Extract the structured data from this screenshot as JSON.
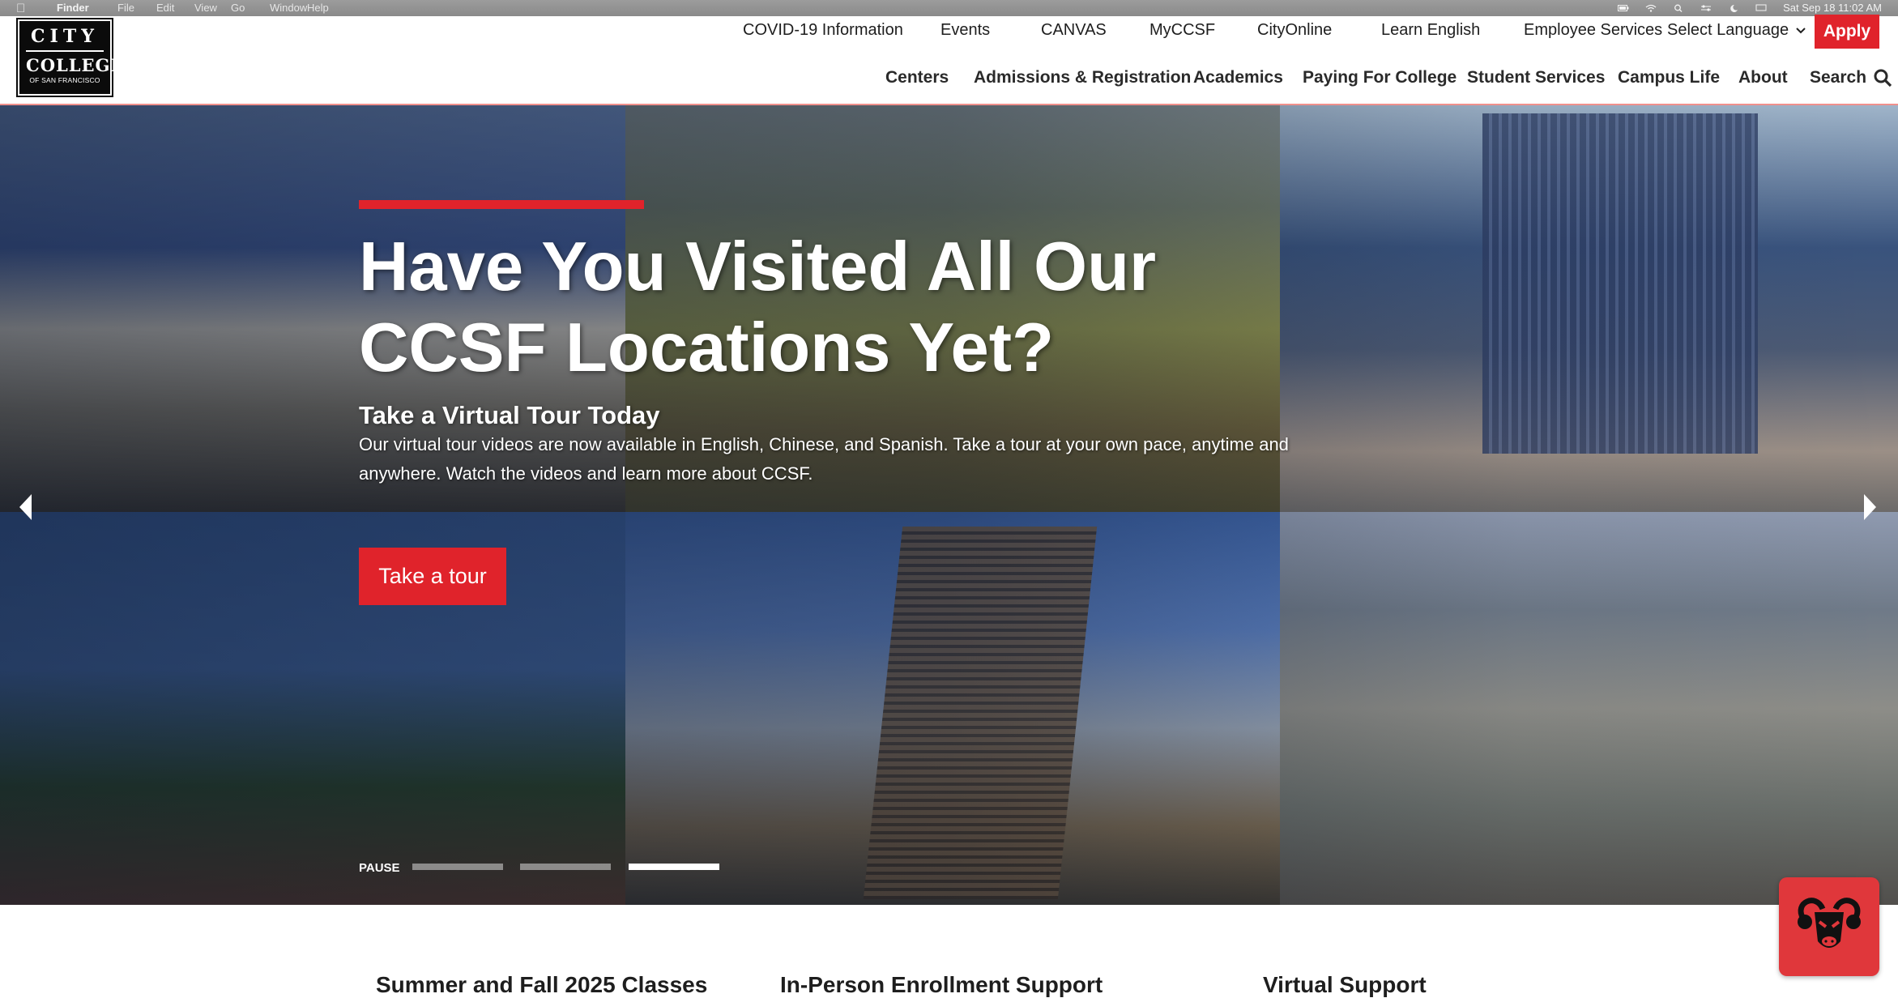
{
  "menubar": {
    "app_name": "Finder",
    "items": [
      "File",
      "Edit",
      "View",
      "Go",
      "Window",
      "Help"
    ],
    "clock": "Sat Sep 18  11:02 AM"
  },
  "logo": {
    "line1": "CITY",
    "line2": "COLLEGE",
    "line3": "OF SAN FRANCISCO"
  },
  "utility_nav": [
    "COVID-19 Information",
    "Events",
    "CANVAS",
    "MyCCSF",
    "CityOnline",
    "Learn English",
    "Employee Services"
  ],
  "language": {
    "label": "Select Language"
  },
  "apply_label": "Apply",
  "main_nav": [
    "Centers",
    "Admissions & Registration",
    "Academics",
    "Paying For College",
    "Student Services",
    "Campus Life",
    "About"
  ],
  "search_label": "Search",
  "hero": {
    "headline_line1": "Have You Visited All Our",
    "headline_line2": "CCSF Locations Yet?",
    "subheading": "Take a Virtual Tour Today",
    "description": "Our virtual tour videos are now available in English, Chinese, and Spanish. Take a tour at your own pace, anytime and anywhere. Watch the videos and learn more about CCSF.",
    "cta_label": "Take a tour",
    "pause_label": "PAUSE",
    "slide_count": 3,
    "active_slide": 3
  },
  "cards": [
    {
      "title": "Summer and Fall 2025 Classes"
    },
    {
      "title": "In-Person Enrollment Support"
    },
    {
      "title": "Virtual Support"
    }
  ],
  "colors": {
    "brand_red": "#e0232b",
    "header_border": "#f0908c",
    "nav_text": "#2a2a2a"
  },
  "icons": {
    "search": "search-icon",
    "chevron": "chevron-down-icon",
    "prev": "arrow-left-icon",
    "next": "arrow-right-icon",
    "chat": "ram-mascot-icon"
  }
}
